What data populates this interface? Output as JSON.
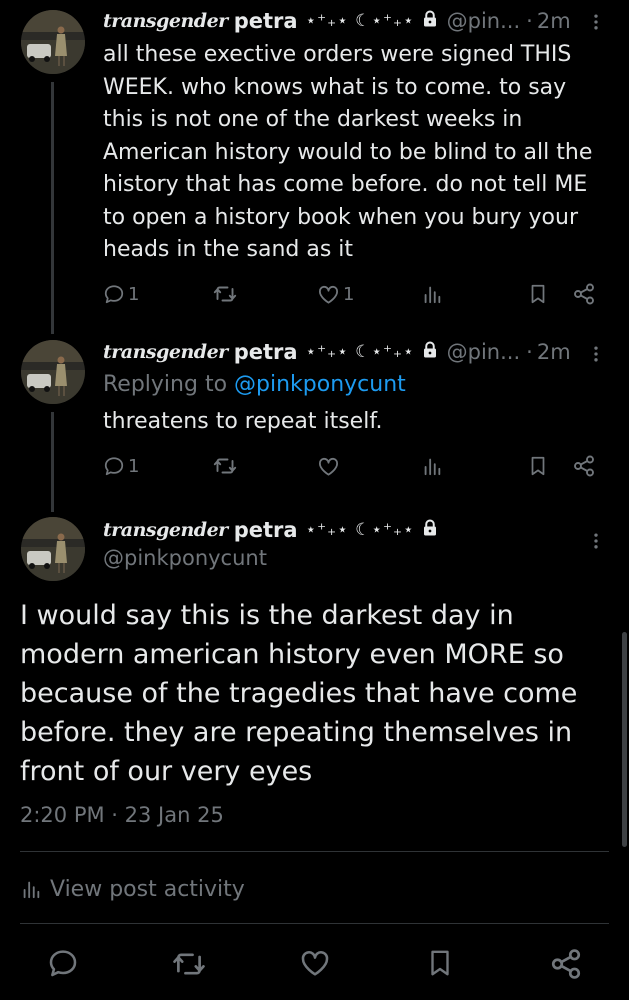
{
  "tweets": [
    {
      "name_script": "transgender",
      "name_plain": "petra",
      "name_deco": "⋆⁺₊⋆ ☾⋆⁺₊⋆",
      "handle": "@pin...",
      "separator": "·",
      "time": "2m",
      "lines": [
        "all these exective orders were signed THIS",
        "WEEK. who knows what is to come. to say",
        "this is not one of the darkest weeks in",
        "American history would to be blind to all the",
        "history that has come before. do not tell ME",
        "to open a history book when you bury your",
        "heads in the sand as it"
      ],
      "replies": "1",
      "likes": "1"
    },
    {
      "name_script": "transgender",
      "name_plain": "petra",
      "name_deco": "⋆⁺₊⋆ ☾⋆⁺₊⋆",
      "handle": "@pin...",
      "separator": "·",
      "time": "2m",
      "replying_label": "Replying to",
      "replying_handle": "@pinkponycunt",
      "text": "threatens to repeat itself.",
      "replies": "1"
    }
  ],
  "main": {
    "name_script": "transgender",
    "name_plain": "petra",
    "name_deco": "⋆⁺₊⋆ ☾⋆⁺₊⋆",
    "handle": "@pinkponycunt",
    "lines": [
      "I would say this is the darkest day in",
      "modern american history even MORE so",
      "because of the tragedies that have come",
      "before. they are repeating themselves in",
      "front of our very eyes"
    ],
    "timestamp": "2:20 PM · 23 Jan 25",
    "view_activity": "View post activity"
  },
  "icons": [
    "reply-icon",
    "retweet-icon",
    "like-icon",
    "views-icon",
    "bookmark-icon",
    "share-icon",
    "lock-icon",
    "more-icon"
  ],
  "colors": {
    "background": "#000000",
    "text": "#e7e9ea",
    "secondary": "#71767b",
    "link": "#1d9bf0",
    "divider": "#2f3336"
  }
}
